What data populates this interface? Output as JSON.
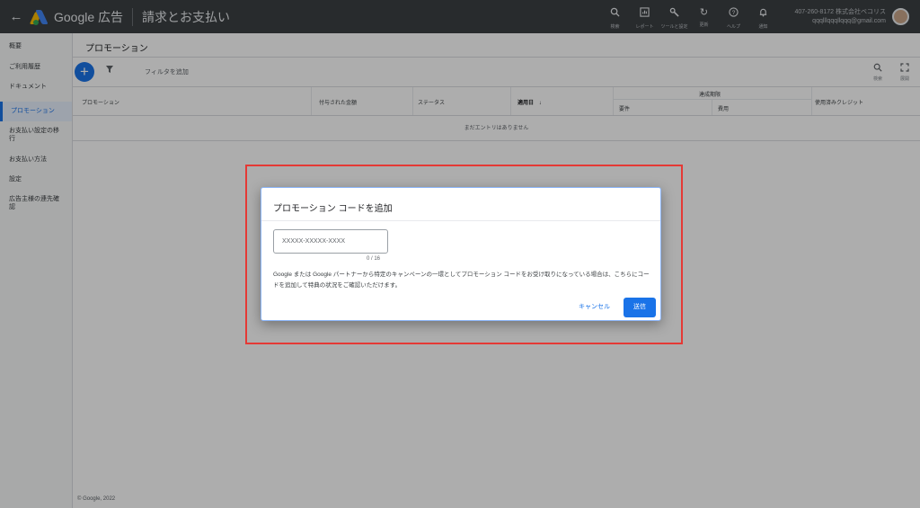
{
  "topbar": {
    "back_icon": "arrow-left-icon",
    "brand": "Google 広告",
    "title": "請求とお支払い",
    "tools": [
      {
        "icon": "search-icon",
        "label": "検索"
      },
      {
        "icon": "reports-icon",
        "label": "レポート"
      },
      {
        "icon": "tools-icon",
        "label": "ツールと設定"
      },
      {
        "icon": "refresh-icon",
        "label": "更新"
      },
      {
        "icon": "help-icon",
        "label": "ヘルプ"
      },
      {
        "icon": "notifications-icon",
        "label": "通知"
      }
    ],
    "account_line1": "407-260-8172 株式会社ベコリス",
    "account_line2": "qqqlllqqqllqqq@gmail.com"
  },
  "sidebar": {
    "items": [
      "概要",
      "ご利用履歴",
      "ドキュメント",
      "プロモーション",
      "お支払い設定の移行",
      "お支払い方法",
      "設定",
      "広告主様の連先確認"
    ],
    "active_index": 3,
    "footer": "© Google, 2022"
  },
  "main": {
    "page_title": "プロモーション",
    "add_icon": "+",
    "filter_placeholder": "フィルタを追加",
    "right_tools": [
      {
        "icon": "search-icon",
        "label": "検索"
      },
      {
        "icon": "fullscreen-icon",
        "label": "展開"
      }
    ],
    "table": {
      "col_promotion": "プロモーション",
      "col_amount": "付与された金額",
      "col_status": "ステータス",
      "col_applied": "適用日",
      "group_header": "達成期限",
      "col_requirement": "要件",
      "col_cost": "費用",
      "col_credit": "使用済みクレジット",
      "empty": "まだエントリはありません"
    }
  },
  "dialog": {
    "title": "プロモーション コードを追加",
    "input_placeholder": "XXXXX-XXXXX-XXXX",
    "input_value": "",
    "counter": "0 / 16",
    "description": "Google または Google パートナーから特定のキャンペーンの一環としてプロモーション コードをお受け取りになっている場合は、こちらにコードを追加して特典の状況をご確認いただけます。",
    "cancel_label": "キャンセル",
    "submit_label": "送信"
  },
  "colors": {
    "accent": "#1a73e8",
    "topbar": "#3c4043",
    "highlight": "#e53935"
  }
}
